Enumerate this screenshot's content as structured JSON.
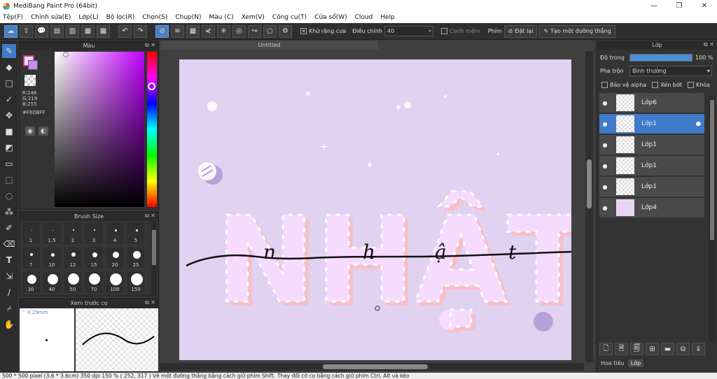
{
  "window": {
    "title": "MediBang Paint Pro (64bit)",
    "min": "—",
    "max": "❐",
    "close": "✕"
  },
  "menu": [
    "Tệp(F)",
    "Chỉnh sửa(E)",
    "Lớp(L)",
    "Bộ lọc(R)",
    "Chọn(S)",
    "Chụp(N)",
    "Màu (C)",
    "Xem(V)",
    "Công cụ(T)",
    "Cửa sổ(W)",
    "Cloud",
    "Help"
  ],
  "toolbar": {
    "antialias_label": "Khử răng cưa",
    "adjust_label": "Điều chỉnh",
    "adjust_value": "40",
    "mesh_label": "Cạnh mềm",
    "key_label": "Phím",
    "reset_label": "Đặt lại",
    "straight_label": "Tạo một đường thẳng"
  },
  "color_panel": {
    "title": "Màu",
    "r": "R:246",
    "g": "G:219",
    "b": "B:255",
    "hex": "#F6DBFF",
    "primary": "#F6DBFF",
    "secondary": "#d23c78"
  },
  "brush_size_panel": {
    "title": "Brush Size",
    "row1": [
      "1",
      "1.5",
      "2",
      "3",
      "4",
      "5"
    ],
    "row2": [
      "7",
      "10",
      "12",
      "15",
      "20",
      "25"
    ],
    "row3": [
      "30",
      "40",
      "50",
      "70",
      "100",
      "150"
    ]
  },
  "preview_panel": {
    "title": "Xem trước cọ",
    "size": "0.29mm"
  },
  "canvas": {
    "tab_title": "Untitled",
    "main_text": "NHẬT",
    "script_letters": [
      "n",
      "h",
      "ậ",
      "t"
    ]
  },
  "layer_panel": {
    "title": "Lớp",
    "opacity_label": "Độ trong",
    "opacity_value": "100 %",
    "blend_label": "Pha trộn",
    "blend_value": "Bình thường",
    "protect_alpha": "Bảo vệ alpha",
    "clipping": "Xén bớt",
    "lock": "Khóa",
    "layers": [
      {
        "name": "Lớp6"
      },
      {
        "name": "Lớp1"
      },
      {
        "name": "Lớp1"
      },
      {
        "name": "Lớp1"
      },
      {
        "name": "Lớp1"
      },
      {
        "name": "Lớp4"
      }
    ],
    "tabs": [
      "Hoa tiêu",
      "Lớp"
    ]
  },
  "status": {
    "text": "500 * 500 pixel   (3.6 * 3.6cm)  350 dpi   150 %   ( 252, 317 )  Vẽ một đường thẳng bằng cách giữ phím Shift. Thay đổi cỡ cọ bằng cách giữ phím Ctrl, Alt và kéo"
  }
}
